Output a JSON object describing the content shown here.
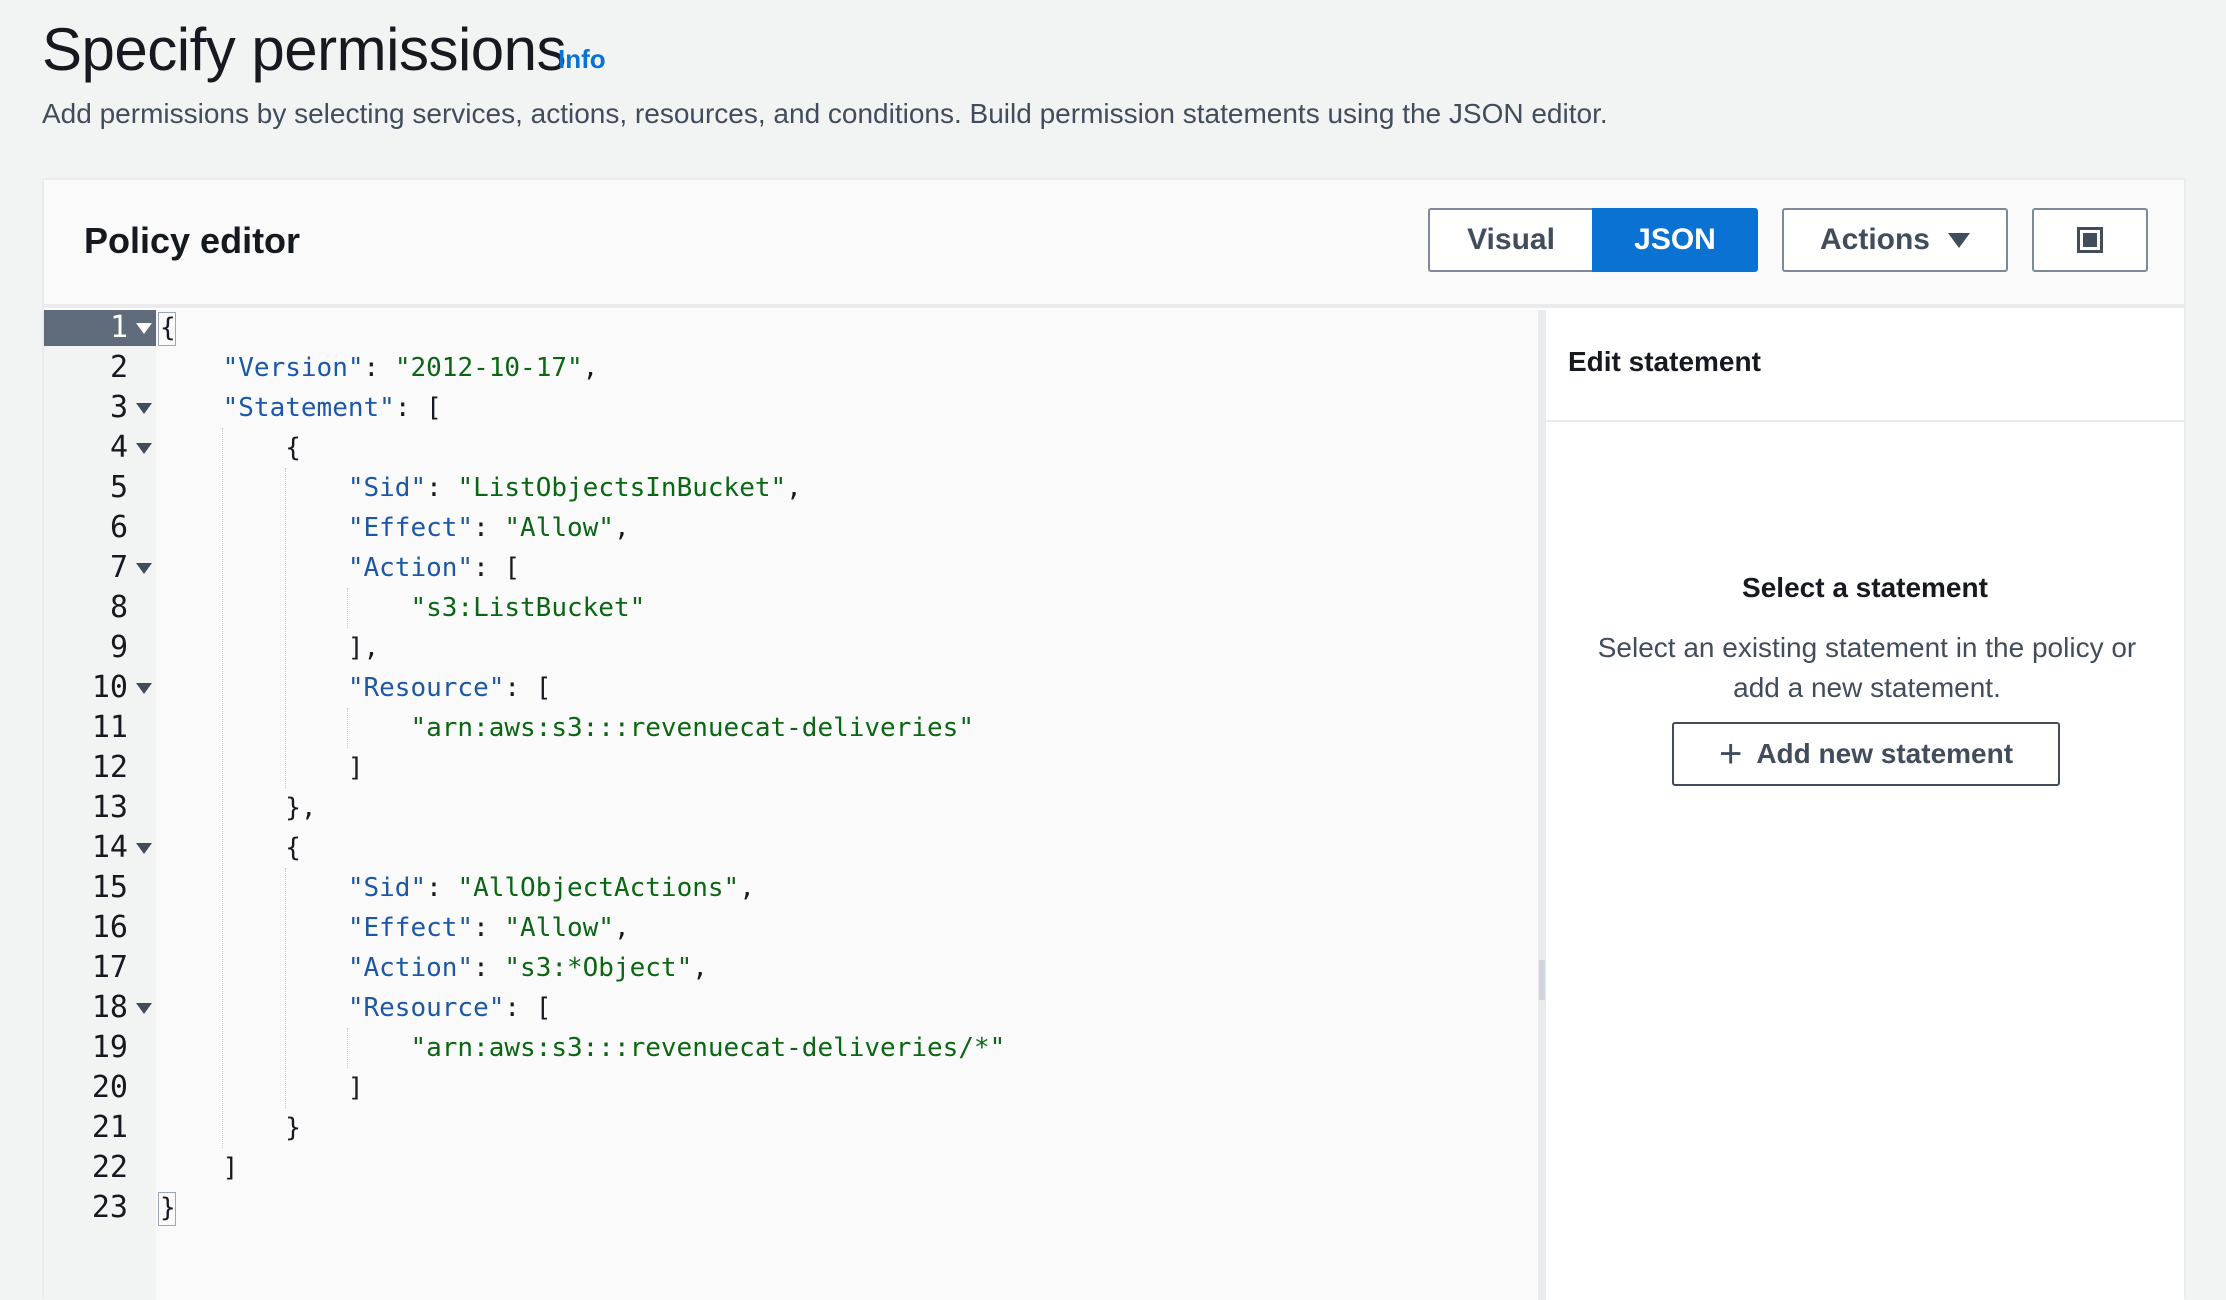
{
  "header": {
    "title": "Specify permissions",
    "info_link": "Info",
    "description": "Add permissions by selecting services, actions, resources, and conditions. Build permission statements using the JSON editor."
  },
  "policy_editor": {
    "title": "Policy editor",
    "toggle": {
      "visual_label": "Visual",
      "json_label": "JSON",
      "selected": "JSON"
    },
    "actions_label": "Actions",
    "split_view_icon": "split-panel-icon"
  },
  "code": {
    "active_line": 1,
    "folded_lines": [
      1,
      3,
      4,
      7,
      10,
      14,
      18
    ],
    "lines": [
      {
        "n": "1",
        "indent": "",
        "tokens": [
          {
            "t": "p",
            "v": "{"
          }
        ]
      },
      {
        "n": "2",
        "indent": "    ",
        "tokens": [
          {
            "t": "k",
            "v": "\"Version\""
          },
          {
            "t": "p",
            "v": ": "
          },
          {
            "t": "s",
            "v": "\"2012-10-17\""
          },
          {
            "t": "p",
            "v": ","
          }
        ]
      },
      {
        "n": "3",
        "indent": "    ",
        "tokens": [
          {
            "t": "k",
            "v": "\"Statement\""
          },
          {
            "t": "p",
            "v": ": ["
          }
        ]
      },
      {
        "n": "4",
        "indent": "        ",
        "tokens": [
          {
            "t": "p",
            "v": "{"
          }
        ]
      },
      {
        "n": "5",
        "indent": "            ",
        "tokens": [
          {
            "t": "k",
            "v": "\"Sid\""
          },
          {
            "t": "p",
            "v": ": "
          },
          {
            "t": "s",
            "v": "\"ListObjectsInBucket\""
          },
          {
            "t": "p",
            "v": ","
          }
        ]
      },
      {
        "n": "6",
        "indent": "            ",
        "tokens": [
          {
            "t": "k",
            "v": "\"Effect\""
          },
          {
            "t": "p",
            "v": ": "
          },
          {
            "t": "s",
            "v": "\"Allow\""
          },
          {
            "t": "p",
            "v": ","
          }
        ]
      },
      {
        "n": "7",
        "indent": "            ",
        "tokens": [
          {
            "t": "k",
            "v": "\"Action\""
          },
          {
            "t": "p",
            "v": ": ["
          }
        ]
      },
      {
        "n": "8",
        "indent": "                ",
        "tokens": [
          {
            "t": "s",
            "v": "\"s3:ListBucket\""
          }
        ]
      },
      {
        "n": "9",
        "indent": "            ",
        "tokens": [
          {
            "t": "p",
            "v": "],"
          }
        ]
      },
      {
        "n": "10",
        "indent": "            ",
        "tokens": [
          {
            "t": "k",
            "v": "\"Resource\""
          },
          {
            "t": "p",
            "v": ": ["
          }
        ]
      },
      {
        "n": "11",
        "indent": "                ",
        "tokens": [
          {
            "t": "s",
            "v": "\"arn:aws:s3:::revenuecat-deliveries\""
          }
        ]
      },
      {
        "n": "12",
        "indent": "            ",
        "tokens": [
          {
            "t": "p",
            "v": "]"
          }
        ]
      },
      {
        "n": "13",
        "indent": "        ",
        "tokens": [
          {
            "t": "p",
            "v": "},"
          }
        ]
      },
      {
        "n": "14",
        "indent": "        ",
        "tokens": [
          {
            "t": "p",
            "v": "{"
          }
        ]
      },
      {
        "n": "15",
        "indent": "            ",
        "tokens": [
          {
            "t": "k",
            "v": "\"Sid\""
          },
          {
            "t": "p",
            "v": ": "
          },
          {
            "t": "s",
            "v": "\"AllObjectActions\""
          },
          {
            "t": "p",
            "v": ","
          }
        ]
      },
      {
        "n": "16",
        "indent": "            ",
        "tokens": [
          {
            "t": "k",
            "v": "\"Effect\""
          },
          {
            "t": "p",
            "v": ": "
          },
          {
            "t": "s",
            "v": "\"Allow\""
          },
          {
            "t": "p",
            "v": ","
          }
        ]
      },
      {
        "n": "17",
        "indent": "            ",
        "tokens": [
          {
            "t": "k",
            "v": "\"Action\""
          },
          {
            "t": "p",
            "v": ": "
          },
          {
            "t": "s",
            "v": "\"s3:*Object\""
          },
          {
            "t": "p",
            "v": ","
          }
        ]
      },
      {
        "n": "18",
        "indent": "            ",
        "tokens": [
          {
            "t": "k",
            "v": "\"Resource\""
          },
          {
            "t": "p",
            "v": ": ["
          }
        ]
      },
      {
        "n": "19",
        "indent": "                ",
        "tokens": [
          {
            "t": "s",
            "v": "\"arn:aws:s3:::revenuecat-deliveries/*\""
          }
        ]
      },
      {
        "n": "20",
        "indent": "            ",
        "tokens": [
          {
            "t": "p",
            "v": "]"
          }
        ]
      },
      {
        "n": "21",
        "indent": "        ",
        "tokens": [
          {
            "t": "p",
            "v": "}"
          }
        ]
      },
      {
        "n": "22",
        "indent": "    ",
        "tokens": [
          {
            "t": "p",
            "v": "]"
          }
        ]
      },
      {
        "n": "23",
        "indent": "",
        "tokens": [
          {
            "t": "p",
            "v": "}"
          }
        ]
      }
    ]
  },
  "side_panel": {
    "title": "Edit statement",
    "empty_title": "Select a statement",
    "empty_description": "Select an existing statement in the policy or add a new statement.",
    "add_button": "Add new statement"
  },
  "colors": {
    "accent": "#0972d3",
    "json_key": "#1d58a8",
    "json_string": "#0b6613"
  }
}
